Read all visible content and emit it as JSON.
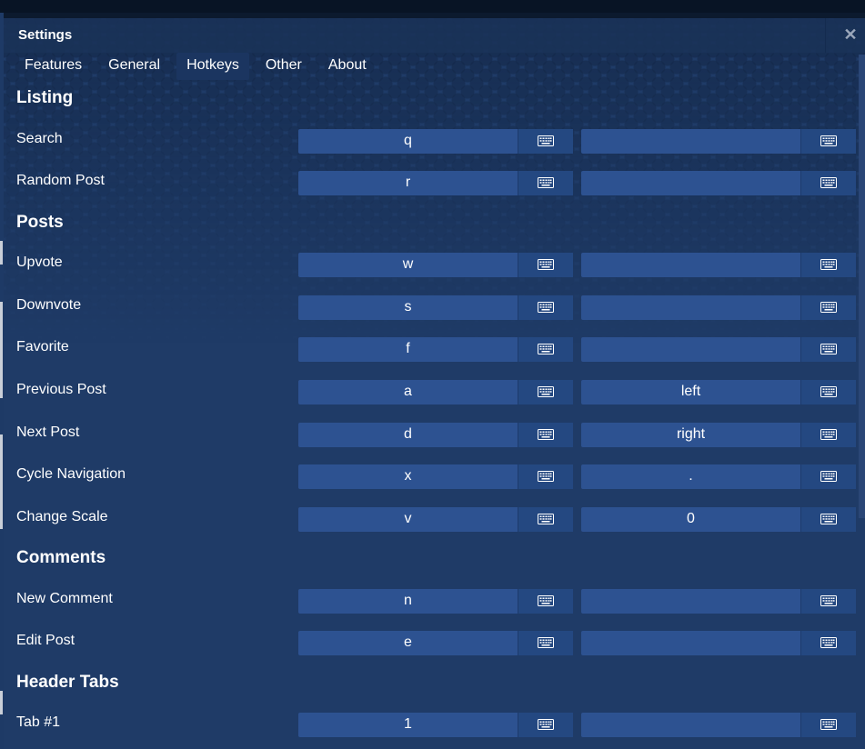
{
  "window": {
    "title": "Settings"
  },
  "tabs": [
    {
      "label": "Features"
    },
    {
      "label": "General"
    },
    {
      "label": "Hotkeys"
    },
    {
      "label": "Other"
    },
    {
      "label": "About"
    }
  ],
  "active_tab": "Hotkeys",
  "sections": [
    {
      "title": "Listing",
      "rows": [
        {
          "label": "Search",
          "primary": "q",
          "secondary": ""
        },
        {
          "label": "Random Post",
          "primary": "r",
          "secondary": ""
        }
      ]
    },
    {
      "title": "Posts",
      "rows": [
        {
          "label": "Upvote",
          "primary": "w",
          "secondary": ""
        },
        {
          "label": "Downvote",
          "primary": "s",
          "secondary": ""
        },
        {
          "label": "Favorite",
          "primary": "f",
          "secondary": ""
        },
        {
          "label": "Previous Post",
          "primary": "a",
          "secondary": "left"
        },
        {
          "label": "Next Post",
          "primary": "d",
          "secondary": "right"
        },
        {
          "label": "Cycle Navigation",
          "primary": "x",
          "secondary": "."
        },
        {
          "label": "Change Scale",
          "primary": "v",
          "secondary": "0"
        }
      ]
    },
    {
      "title": "Comments",
      "rows": [
        {
          "label": "New Comment",
          "primary": "n",
          "secondary": ""
        },
        {
          "label": "Edit Post",
          "primary": "e",
          "secondary": ""
        }
      ]
    },
    {
      "title": "Header Tabs",
      "rows": [
        {
          "label": "Tab #1",
          "primary": "1",
          "secondary": ""
        }
      ]
    }
  ],
  "icons": {
    "close": "close-icon",
    "record": "keyboard-icon"
  },
  "colors": {
    "window_bg": "#1f3b67",
    "field_bg": "#2d5291",
    "button_bg": "#244881",
    "text": "#ffffff"
  }
}
